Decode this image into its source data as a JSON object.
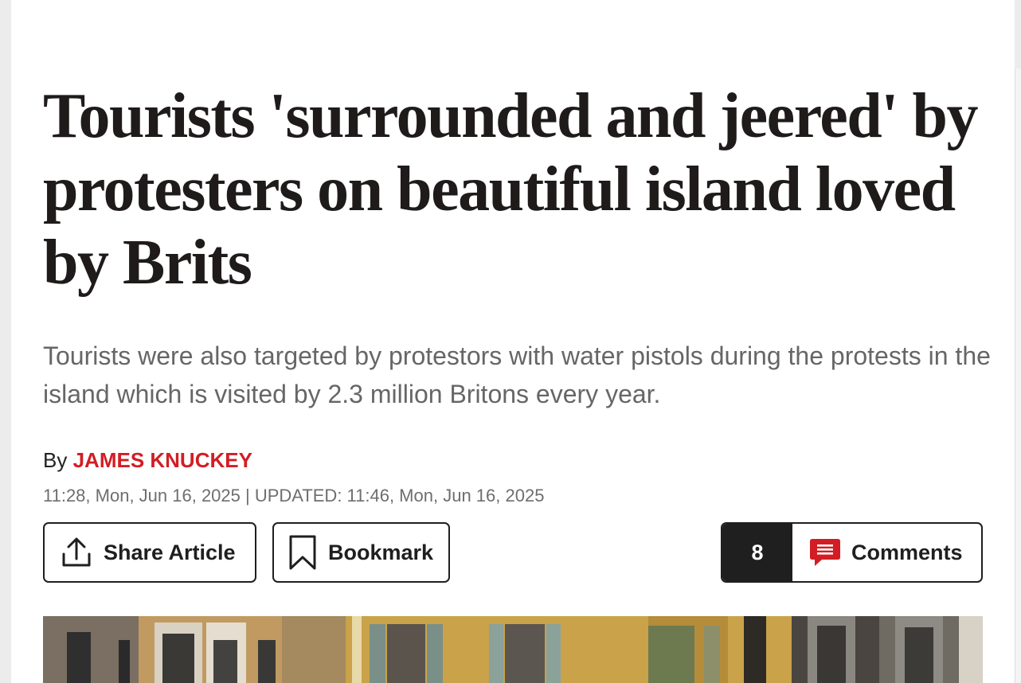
{
  "article": {
    "headline": "Tourists 'surrounded and jeered' by protesters on beautiful island loved by Brits",
    "standfirst": "Tourists were also targeted by protestors with water pistols during the protests in the island which is visited by 2.3 million Britons every year.",
    "byline_prefix": "By",
    "author": "JAMES KNUCKEY",
    "dateline": "11:28, Mon, Jun 16, 2025 | UPDATED: 11:46, Mon, Jun 16, 2025"
  },
  "actions": {
    "share_label": "Share Article",
    "share_icon": "share-upload-icon",
    "bookmark_label": "Bookmark",
    "bookmark_icon": "bookmark-icon",
    "comments_count": "8",
    "comments_label": "Comments",
    "comments_icon": "comment-bubble-icon"
  },
  "colors": {
    "accent": "#d31d24",
    "text": "#1f1b1b",
    "muted": "#666666",
    "button_dark": "#1f1f1f"
  }
}
